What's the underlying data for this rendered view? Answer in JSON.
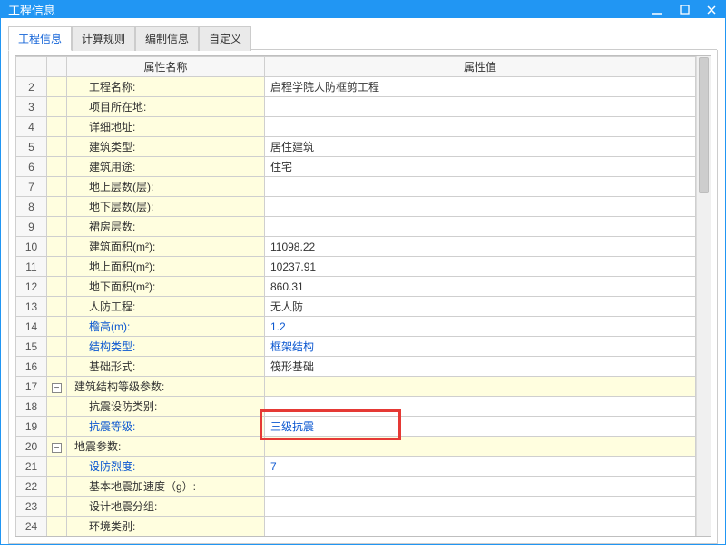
{
  "window": {
    "title": "工程信息"
  },
  "tabs": [
    "工程信息",
    "计算规则",
    "编制信息",
    "自定义"
  ],
  "active_tab": 0,
  "columns": {
    "name": "属性名称",
    "value": "属性值"
  },
  "rows": [
    {
      "n": 2,
      "indent": 1,
      "name": "工程名称:",
      "value": "启程学院人防框剪工程"
    },
    {
      "n": 3,
      "indent": 1,
      "name": "项目所在地:",
      "value": ""
    },
    {
      "n": 4,
      "indent": 1,
      "name": "详细地址:",
      "value": ""
    },
    {
      "n": 5,
      "indent": 1,
      "name": "建筑类型:",
      "value": "居住建筑"
    },
    {
      "n": 6,
      "indent": 1,
      "name": "建筑用途:",
      "value": "住宅"
    },
    {
      "n": 7,
      "indent": 1,
      "name": "地上层数(层):",
      "value": ""
    },
    {
      "n": 8,
      "indent": 1,
      "name": "地下层数(层):",
      "value": ""
    },
    {
      "n": 9,
      "indent": 1,
      "name": "裙房层数:",
      "value": ""
    },
    {
      "n": 10,
      "indent": 1,
      "name": "建筑面积(m²):",
      "value": "11098.22"
    },
    {
      "n": 11,
      "indent": 1,
      "name": "地上面积(m²):",
      "value": "10237.91"
    },
    {
      "n": 12,
      "indent": 1,
      "name": "地下面积(m²):",
      "value": "860.31"
    },
    {
      "n": 13,
      "indent": 1,
      "name": "人防工程:",
      "value": "无人防"
    },
    {
      "n": 14,
      "indent": 1,
      "name": "檐高(m):",
      "name_blue": true,
      "value": "1.2",
      "value_blue": true
    },
    {
      "n": 15,
      "indent": 1,
      "name": "结构类型:",
      "name_blue": true,
      "value": "框架结构",
      "value_blue": true
    },
    {
      "n": 16,
      "indent": 1,
      "name": "基础形式:",
      "value": "筏形基础"
    },
    {
      "n": 17,
      "indent": 0,
      "group": true,
      "name": "建筑结构等级参数:",
      "value": ""
    },
    {
      "n": 18,
      "indent": 1,
      "name": "抗震设防类别:",
      "value": ""
    },
    {
      "n": 19,
      "indent": 1,
      "name": "抗震等级:",
      "name_blue": true,
      "value": "三级抗震",
      "value_blue": true,
      "highlight": true
    },
    {
      "n": 20,
      "indent": 0,
      "group": true,
      "name": "地震参数:",
      "value": ""
    },
    {
      "n": 21,
      "indent": 1,
      "name": "设防烈度:",
      "name_blue": true,
      "value": "7",
      "value_blue": true
    },
    {
      "n": 22,
      "indent": 1,
      "name": "基本地震加速度（g）:",
      "value": ""
    },
    {
      "n": 23,
      "indent": 1,
      "name": "设计地震分组:",
      "value": ""
    },
    {
      "n": 24,
      "indent": 1,
      "name": "环境类别:",
      "value": ""
    }
  ]
}
